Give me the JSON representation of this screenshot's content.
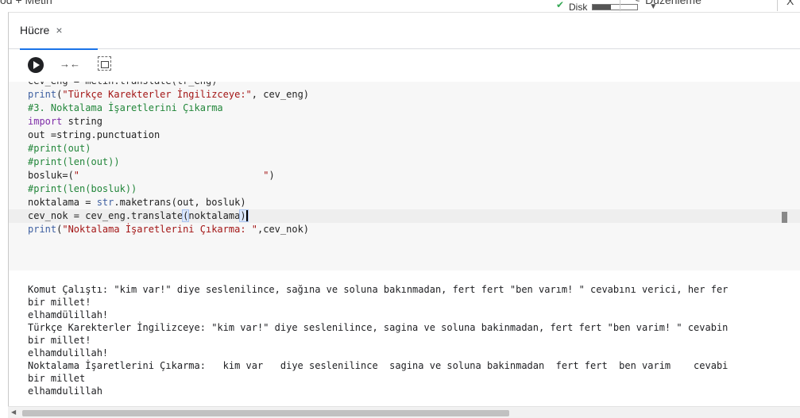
{
  "topbar": {
    "left_clipped": "od  + Metin",
    "disk_label": "Disk",
    "disk_fill": 0.4,
    "edit_label": "Düzenleme",
    "close_symbol": "X"
  },
  "tab": {
    "label": "Hücre",
    "close": "×"
  },
  "icons": {
    "more": "⋮",
    "run": "play-icon",
    "collapse": "→←",
    "scratch": "scratch-cell-icon"
  },
  "code": {
    "clipped_top": "cev_eng = metin.translate(tr_eng)",
    "l1_fn": "print",
    "l1_a": "(",
    "l1_str": "\"Türkçe Karekterler İngilizceye:\"",
    "l1_b": ", cev_eng)",
    "l2": "#3. Noktalama İşaretlerini Çıkarma",
    "l3_kw": "import",
    "l3_rest": " string",
    "l4": "out =string.punctuation",
    "l5": "#print(out)",
    "l6": "#print(len(out))",
    "l7_a": "bosluk=(",
    "l7_str": "\"                                \"",
    "l7_b": ")",
    "l8": "#print(len(bosluk))",
    "l9_a": "noktalama = ",
    "l9_kw": "str",
    "l9_b": ".maketrans(out, bosluk)",
    "l10_a": "cev_nok = cev_eng.translate",
    "l10_open": "(",
    "l10_mid": "noktalama",
    "l10_close": ")",
    "l11_fn": "print",
    "l11_a": "(",
    "l11_str": "\"Noktalama İşaretlerini Çıkarma: \"",
    "l11_b": ",cev_nok)"
  },
  "output": [
    "Komut Çalıştı: \"kim var!\" diye seslenilince, sağına ve soluna bakınmadan, fert fert \"ben varım! \" cevabını verici, her fer",
    "bir millet!",
    "elhamdülillah!",
    "Türkçe Karekterler İngilizceye: \"kim var!\" diye seslenilince, sagina ve soluna bakinmadan, fert fert \"ben varim! \" cevabin",
    "bir millet!",
    "elhamdulillah!",
    "Noktalama İşaretlerini Çıkarma:   kim var   diye seslenilince  sagina ve soluna bakinmadan  fert fert  ben varim    cevabi",
    "bir millet",
    "elhamdulillah"
  ]
}
